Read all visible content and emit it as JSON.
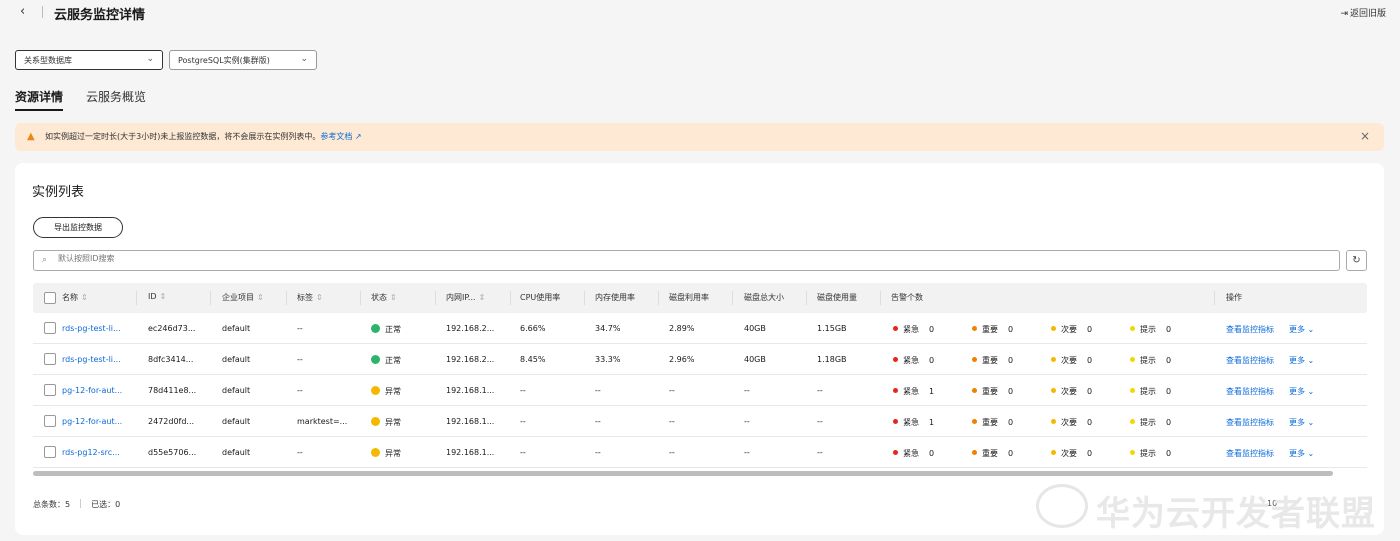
{
  "header": {
    "title": "云服务监控详情",
    "return_label": "返回旧版"
  },
  "filters": {
    "db_type": "关系型数据库",
    "instance_type": "PostgreSQL实例(集群版)"
  },
  "tabs": [
    {
      "label": "资源详情",
      "active": true
    },
    {
      "label": "云服务概览",
      "active": false
    }
  ],
  "alert": {
    "text": "如实例超过一定时长(大于3小时)未上报监控数据，将不会展示在实例列表中。",
    "link": "参考文档"
  },
  "card": {
    "title": "实例列表",
    "export_label": "导出监控数据",
    "search_placeholder": "默认按照ID搜索"
  },
  "table": {
    "headers": {
      "name": "名称",
      "id": "ID",
      "project": "企业项目",
      "tags": "标签",
      "status": "状态",
      "ip": "内网IP...",
      "cpu": "CPU使用率",
      "mem": "内存使用率",
      "disk_util": "磁盘利用率",
      "disk_total": "磁盘总大小",
      "disk_used": "磁盘使用量",
      "alarms": "告警个数",
      "ops": "操作"
    },
    "alarm_labels": {
      "critical": "紧急",
      "major": "重要",
      "minor": "次要",
      "info": "提示"
    },
    "op_view": "查看监控指标",
    "op_more": "更多",
    "rows": [
      {
        "name": "rds-pg-test-li...",
        "id": "ec246d73...",
        "project": "default",
        "tags": "--",
        "status": "正常",
        "status_kind": "normal",
        "ip": "192.168.2...",
        "cpu": "6.66%",
        "mem": "34.7%",
        "disk_util": "2.89%",
        "disk_total": "40GB",
        "disk_used": "1.15GB",
        "critical": "0",
        "major": "0",
        "minor": "0",
        "info": "0"
      },
      {
        "name": "rds-pg-test-li...",
        "id": "8dfc3414...",
        "project": "default",
        "tags": "--",
        "status": "正常",
        "status_kind": "normal",
        "ip": "192.168.2...",
        "cpu": "8.45%",
        "mem": "33.3%",
        "disk_util": "2.96%",
        "disk_total": "40GB",
        "disk_used": "1.18GB",
        "critical": "0",
        "major": "0",
        "minor": "0",
        "info": "0"
      },
      {
        "name": "pg-12-for-aut...",
        "id": "78d411e8...",
        "project": "default",
        "tags": "--",
        "status": "异常",
        "status_kind": "abnormal",
        "ip": "192.168.1...",
        "cpu": "--",
        "mem": "--",
        "disk_util": "--",
        "disk_total": "--",
        "disk_used": "--",
        "critical": "1",
        "major": "0",
        "minor": "0",
        "info": "0"
      },
      {
        "name": "pg-12-for-aut...",
        "id": "2472d0fd...",
        "project": "default",
        "tags": "marktest=...",
        "status": "异常",
        "status_kind": "abnormal",
        "ip": "192.168.1...",
        "cpu": "--",
        "mem": "--",
        "disk_util": "--",
        "disk_total": "--",
        "disk_used": "--",
        "critical": "1",
        "major": "0",
        "minor": "0",
        "info": "0"
      },
      {
        "name": "rds-pg12-src...",
        "id": "d55e5706...",
        "project": "default",
        "tags": "--",
        "status": "异常",
        "status_kind": "abnormal",
        "ip": "192.168.1...",
        "cpu": "--",
        "mem": "--",
        "disk_util": "--",
        "disk_total": "--",
        "disk_used": "--",
        "critical": "0",
        "major": "0",
        "minor": "0",
        "info": "0"
      }
    ]
  },
  "footer": {
    "total_label": "总条数：",
    "total": "5",
    "selected_label": "已选：",
    "selected": "0",
    "page_size": "10"
  },
  "watermark": "华为云开发者联盟",
  "colors": {
    "link": "#0a6bd8",
    "normal": "#2db36b",
    "abnormal": "#f5b800",
    "critical": "#e5261f",
    "major": "#f08000",
    "minor": "#f5b800",
    "info": "#f2d700",
    "alert_bg": "#fde9d4"
  }
}
